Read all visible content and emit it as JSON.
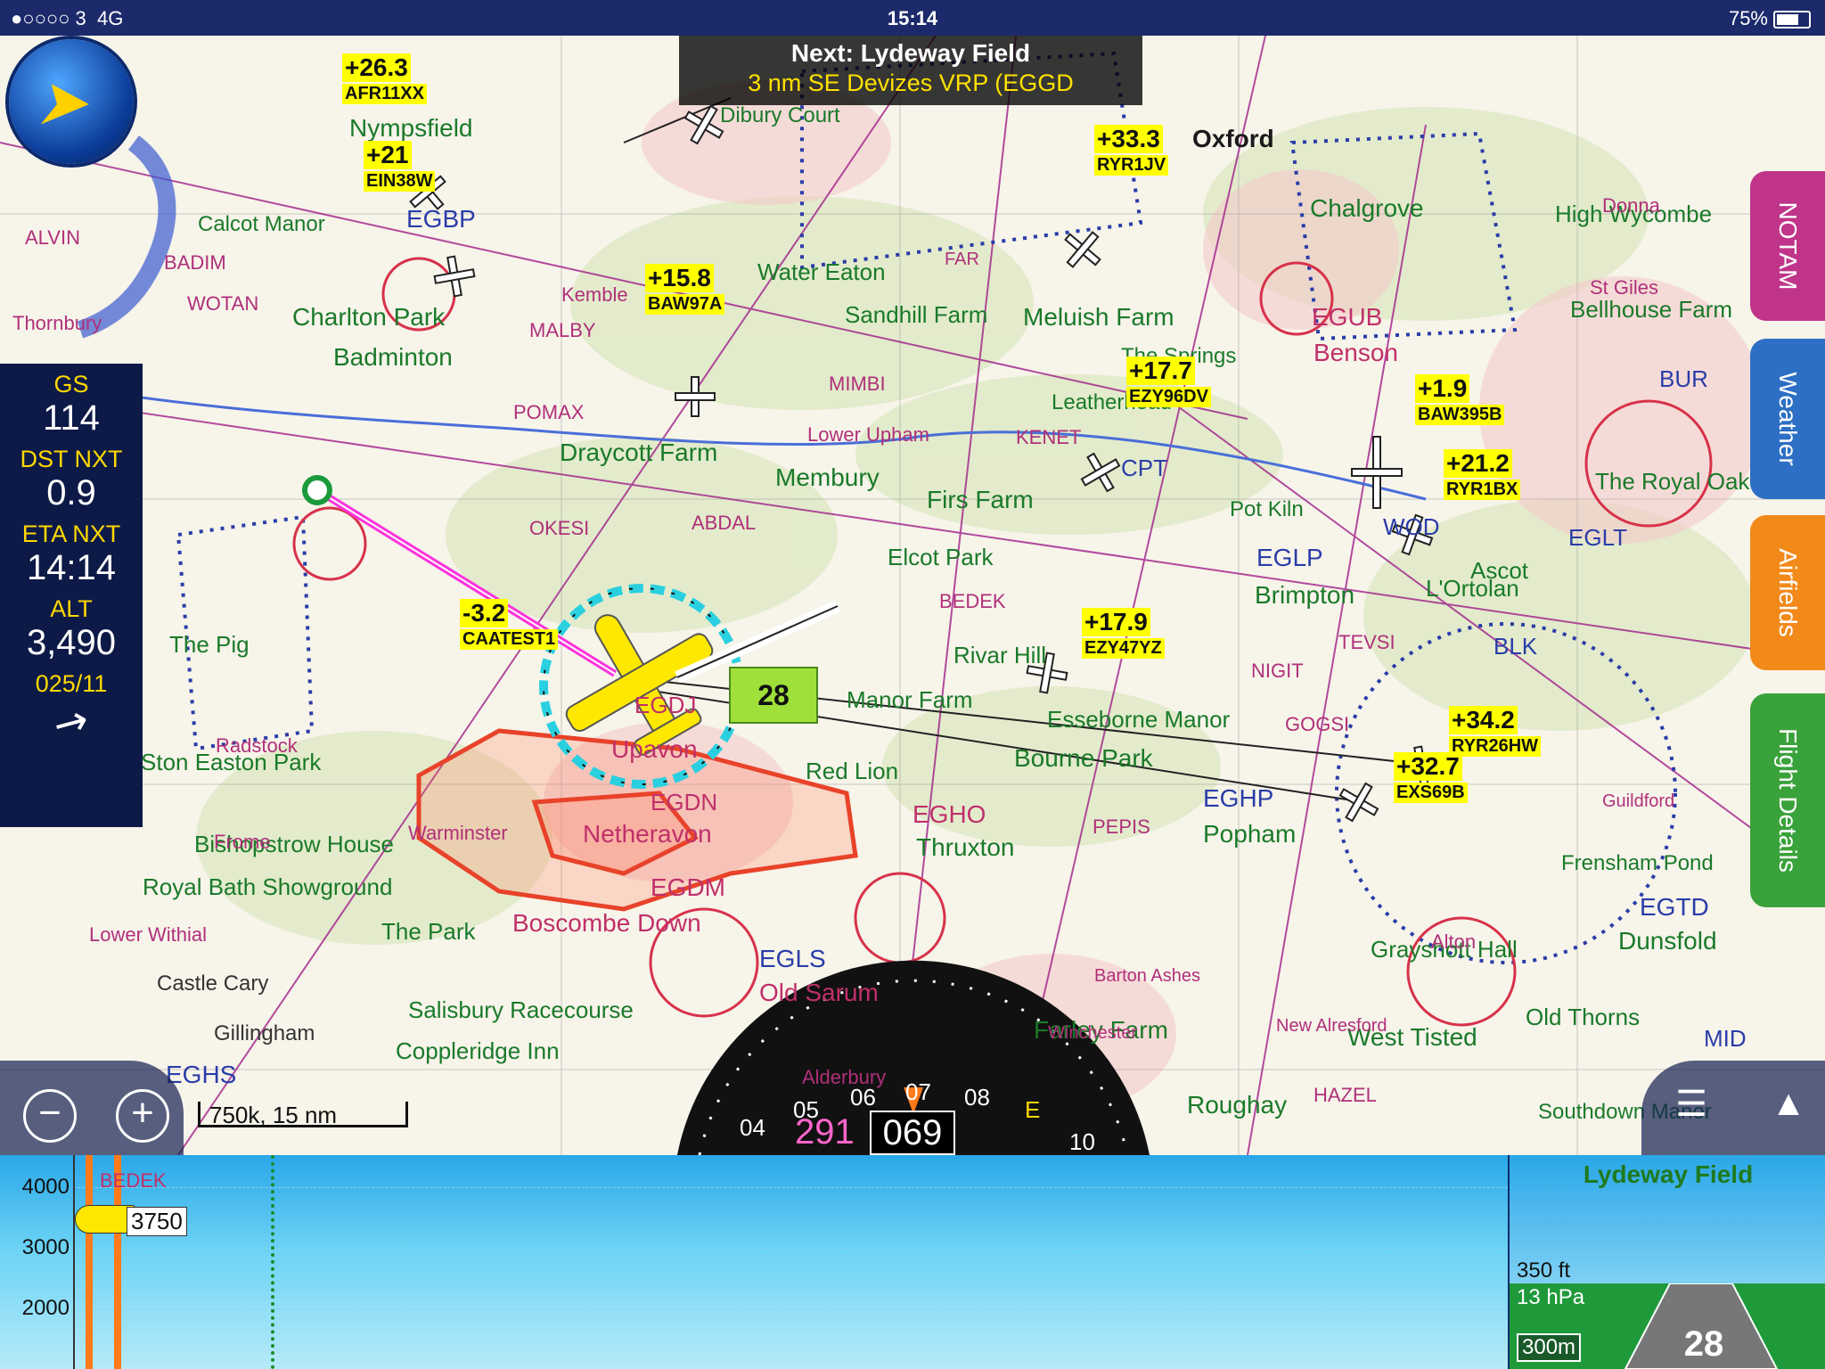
{
  "status_bar": {
    "carrier": "●○○○○ 3",
    "network": "4G",
    "time": "15:14",
    "battery": "75%",
    "battery_fraction": 0.75
  },
  "next_waypoint": {
    "title": "Next: Lydeway Field",
    "detail": "3 nm SE Devizes VRP (EGGD"
  },
  "instruments": {
    "gs_label": "GS",
    "gs_value": "114",
    "dst_label": "DST NXT",
    "dst_value": "0.9",
    "eta_label": "ETA NXT",
    "eta_value": "14:14",
    "alt_label": "ALT",
    "alt_value": "3,490",
    "wind_value": "025/11"
  },
  "side_tabs": [
    {
      "label": "NOTAM",
      "color": "#c0348a"
    },
    {
      "label": "Weather",
      "color": "#2c6fc4"
    },
    {
      "label": "Airfields",
      "color": "#f28a1a"
    },
    {
      "label": "Flight Details",
      "color": "#3aa23a"
    }
  ],
  "map": {
    "scale": "750k, 15 nm",
    "waypoint_badge": "28",
    "ownship": "CAATEST1",
    "ownship_alt": "-3.2",
    "heading_readout": "069",
    "track_readout": "291",
    "compass_marks": [
      "04",
      "05",
      "06",
      "07",
      "08",
      "E",
      "10"
    ],
    "places": [
      "Nympsfield",
      "Calcot Manor",
      "Charlton Park",
      "Badminton",
      "Draycott Farm",
      "Membury",
      "Firs Farm",
      "Sandhill Farm",
      "Water Eaton",
      "Meluish Farm",
      "Chalgrove",
      "Benson",
      "Oxford",
      "High Wycombe",
      "Bellhouse Farm",
      "Elcot Park",
      "Brimpton",
      "Rivar Hill",
      "Manor Farm",
      "Esseborne Manor",
      "Bourne Park",
      "Popham",
      "Thruxton",
      "Red Lion",
      "Upavon",
      "Netheravon",
      "Boscombe Down",
      "Old Sarum",
      "Salisbury Racecourse",
      "Coppleridge Inn",
      "The Park",
      "Royal Bath Showground",
      "Bishopstrow House",
      "Ston Easton Park",
      "The Pig",
      "Farley Farm",
      "West Tisted",
      "Grayshott Hall",
      "Old Thorns",
      "Dunsfold",
      "Frensham Pond",
      "L'Ortolan",
      "Ascot",
      "The Royal Oak",
      "Roughay",
      "Southdown Manor",
      "Lower Upham",
      "Dibury Court",
      "Kemble",
      "The Springs",
      "Leatherhead",
      "Pot Kiln",
      "Castle Cary",
      "Gillingham",
      "Lower Withial"
    ],
    "airspace_labels": [
      "EGBP",
      "EGUB",
      "EGDM",
      "EGLS",
      "EGHO",
      "EGHP",
      "EGLP",
      "EGLT",
      "EGTD",
      "EGHS",
      "EGDJ",
      "EGDN",
      "MALBY",
      "WOTAN",
      "BADIM",
      "ALVIN",
      "POMAX",
      "KENET",
      "ABDAL",
      "OKESI",
      "BEDEK",
      "TEVSI",
      "NIGIT",
      "GOGSI",
      "PEPIS",
      "HAZEL",
      "MIMBI",
      "FAR",
      "CPT",
      "WOD",
      "BUR",
      "MID",
      "BLK",
      "Thornbury",
      "Radstock",
      "Warminster",
      "Frome",
      "Alderbury",
      "Winchester",
      "New Alresford",
      "Barton Ashes",
      "Alton",
      "Guildford",
      "Donna",
      "St Giles"
    ],
    "traffic": [
      {
        "alt": "+26.3",
        "callsign": "AFR11XX"
      },
      {
        "alt": "+21",
        "callsign": "EIN38W"
      },
      {
        "alt": "+33.3",
        "callsign": "RYR1JV"
      },
      {
        "alt": "+15.8",
        "callsign": "BAW97A"
      },
      {
        "alt": "+17.7",
        "callsign": "EZY96DV"
      },
      {
        "alt": "+1.9",
        "callsign": "BAW395B"
      },
      {
        "alt": "+21.2",
        "callsign": "RYR1BX"
      },
      {
        "alt": "+17.9",
        "callsign": "EZY47YZ"
      },
      {
        "alt": "+34.2",
        "callsign": "RYR26HW"
      },
      {
        "alt": "+32.7",
        "callsign": "EXS69B"
      }
    ]
  },
  "profile": {
    "ticks": [
      "4000",
      "3000",
      "2000"
    ],
    "waypoint": "BEDEK",
    "ownship_alt": "3750",
    "dest_title": "Lydeway Field",
    "dest_elev": "350 ft",
    "dest_qnh": "13 hPa",
    "runway_length": "300m",
    "runway_number": "28"
  }
}
